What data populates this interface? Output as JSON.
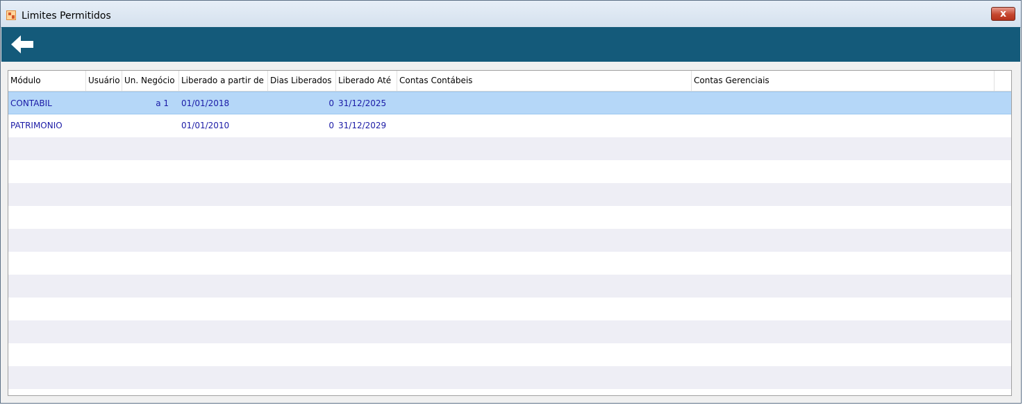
{
  "window": {
    "title": "Limites Permitidos",
    "close_label": "x"
  },
  "toolbar": {
    "back_icon": "arrow-left-icon"
  },
  "grid": {
    "columns": [
      "Módulo",
      "Usuário",
      "Un. Negócio",
      "Liberado a partir de",
      "Dias Liberados",
      "Liberado Até",
      "Contas Contábeis",
      "Contas Gerenciais"
    ],
    "rows": [
      [
        "CONTABIL",
        "",
        "a  1",
        "01/01/2018",
        "0",
        "31/12/2025",
        "",
        ""
      ],
      [
        "PATRIMONIO",
        "",
        "",
        "01/01/2010",
        "0",
        "31/12/2029",
        "",
        ""
      ]
    ],
    "selected_row": 0
  },
  "colors": {
    "toolbar": "#145a7a",
    "selected_row": "#b5d7f8",
    "alt_row": "#eeeef5",
    "cell_text": "#1a1aa6"
  }
}
